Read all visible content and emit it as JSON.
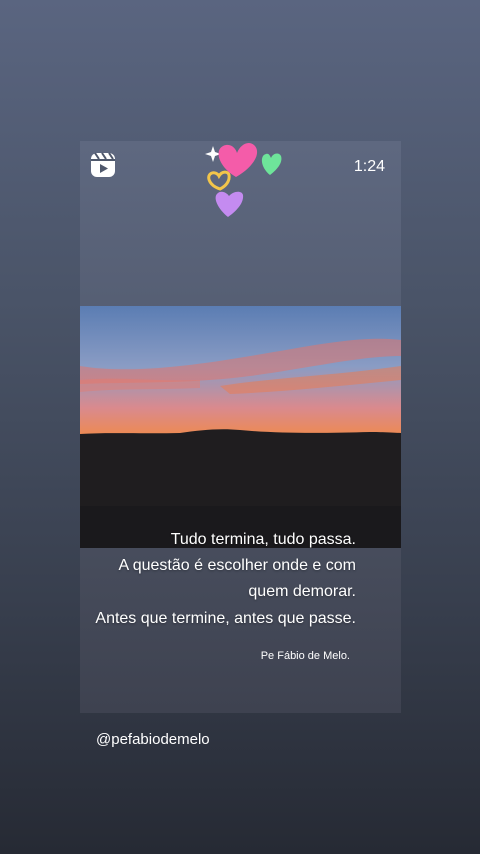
{
  "story": {
    "duration": "1:24",
    "icons": {
      "reel": "reel-icon",
      "stickers": [
        "sparkle-icon",
        "pink-heart-icon",
        "green-heart-icon",
        "yellow-heart-icon",
        "purple-heart-icon"
      ]
    },
    "quote_lines": [
      "Tudo termina, tudo passa.",
      "A questão é escolher onde e com",
      "quem demorar.",
      "Antes que termine, antes que passe."
    ],
    "author": "Pe Fábio de Melo.",
    "mention": "@pefabiodemelo"
  },
  "colors": {
    "sky_top": "#6b88b8",
    "sunset_orange": "#f59a3c",
    "sunset_pink": "#e97a8a",
    "pink_heart": "#f45ca9",
    "green_heart": "#6ee49a",
    "yellow_heart": "#f2c54a",
    "purple_heart": "#c48bf0"
  }
}
